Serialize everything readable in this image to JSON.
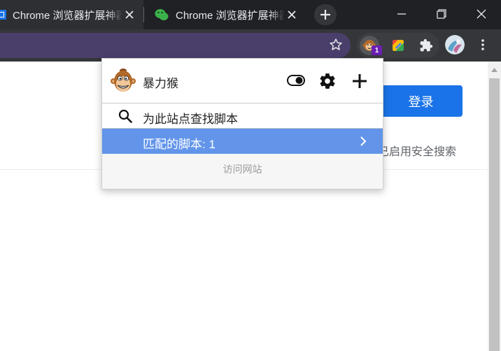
{
  "tabs": [
    {
      "title": "Chrome 浏览器扩展神器",
      "favicon": "window-favicon-icon",
      "active": true
    },
    {
      "title": "Chrome 浏览器扩展神器",
      "favicon": "wechat-icon",
      "active": false
    }
  ],
  "toolbar": {
    "violentmonkey_badge": "1"
  },
  "page": {
    "login_label": "登录",
    "safe_search_text": "已启用安全搜索"
  },
  "popup": {
    "name": "暴力猴",
    "find_scripts_label": "为此站点查找脚本",
    "matched_scripts_label": "匹配的脚本: 1",
    "visit_site_label": "访问网站"
  },
  "colors": {
    "tabstrip_bg": "#202124",
    "toolbar_bg": "#35363a",
    "omnibox_bg": "#4a3f6b",
    "accent_blue": "#1a73e8",
    "match_row_bg": "#6295ea",
    "badge_purple": "#6b1fb1"
  }
}
